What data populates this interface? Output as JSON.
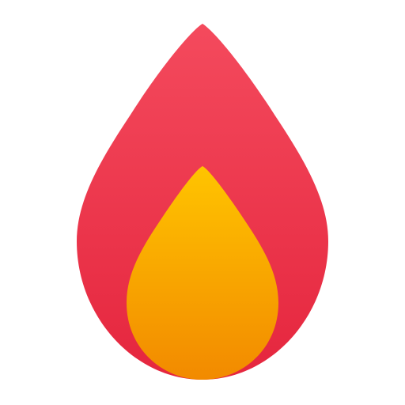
{
  "icon": {
    "name": "flame-icon",
    "outer_color_top": "#f44a5d",
    "outer_color_bottom": "#e5263e",
    "inner_color_top": "#ffc400",
    "inner_color_bottom": "#f28a00",
    "background": "#ffffff"
  }
}
